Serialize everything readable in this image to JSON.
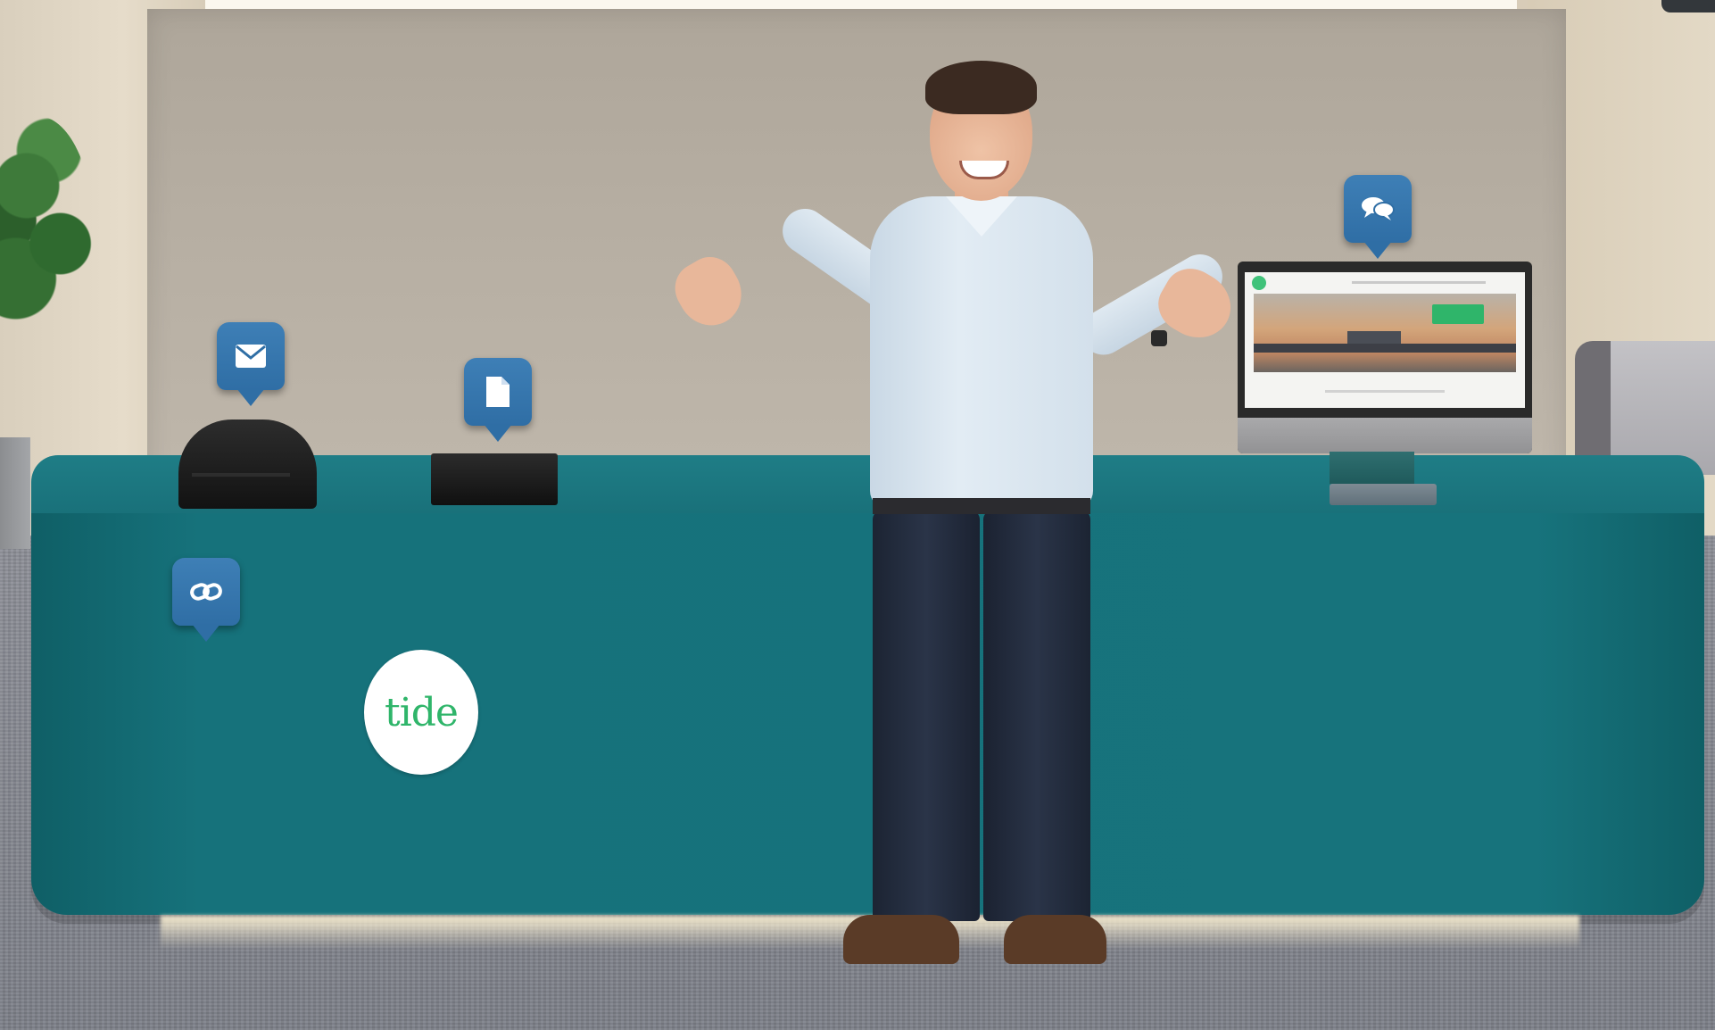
{
  "booth": {
    "logo_text": "tide",
    "accent_color": "#17737c",
    "pin_color": "#2f6ea5",
    "logo_color": "#2fb56a"
  },
  "hotspots": [
    {
      "id": "mail",
      "icon": "envelope-icon"
    },
    {
      "id": "document",
      "icon": "document-icon"
    },
    {
      "id": "chat",
      "icon": "chat-bubbles-icon"
    },
    {
      "id": "link",
      "icon": "link-icon"
    }
  ],
  "monitor": {
    "screen_cta": "",
    "screen_heading": ""
  }
}
